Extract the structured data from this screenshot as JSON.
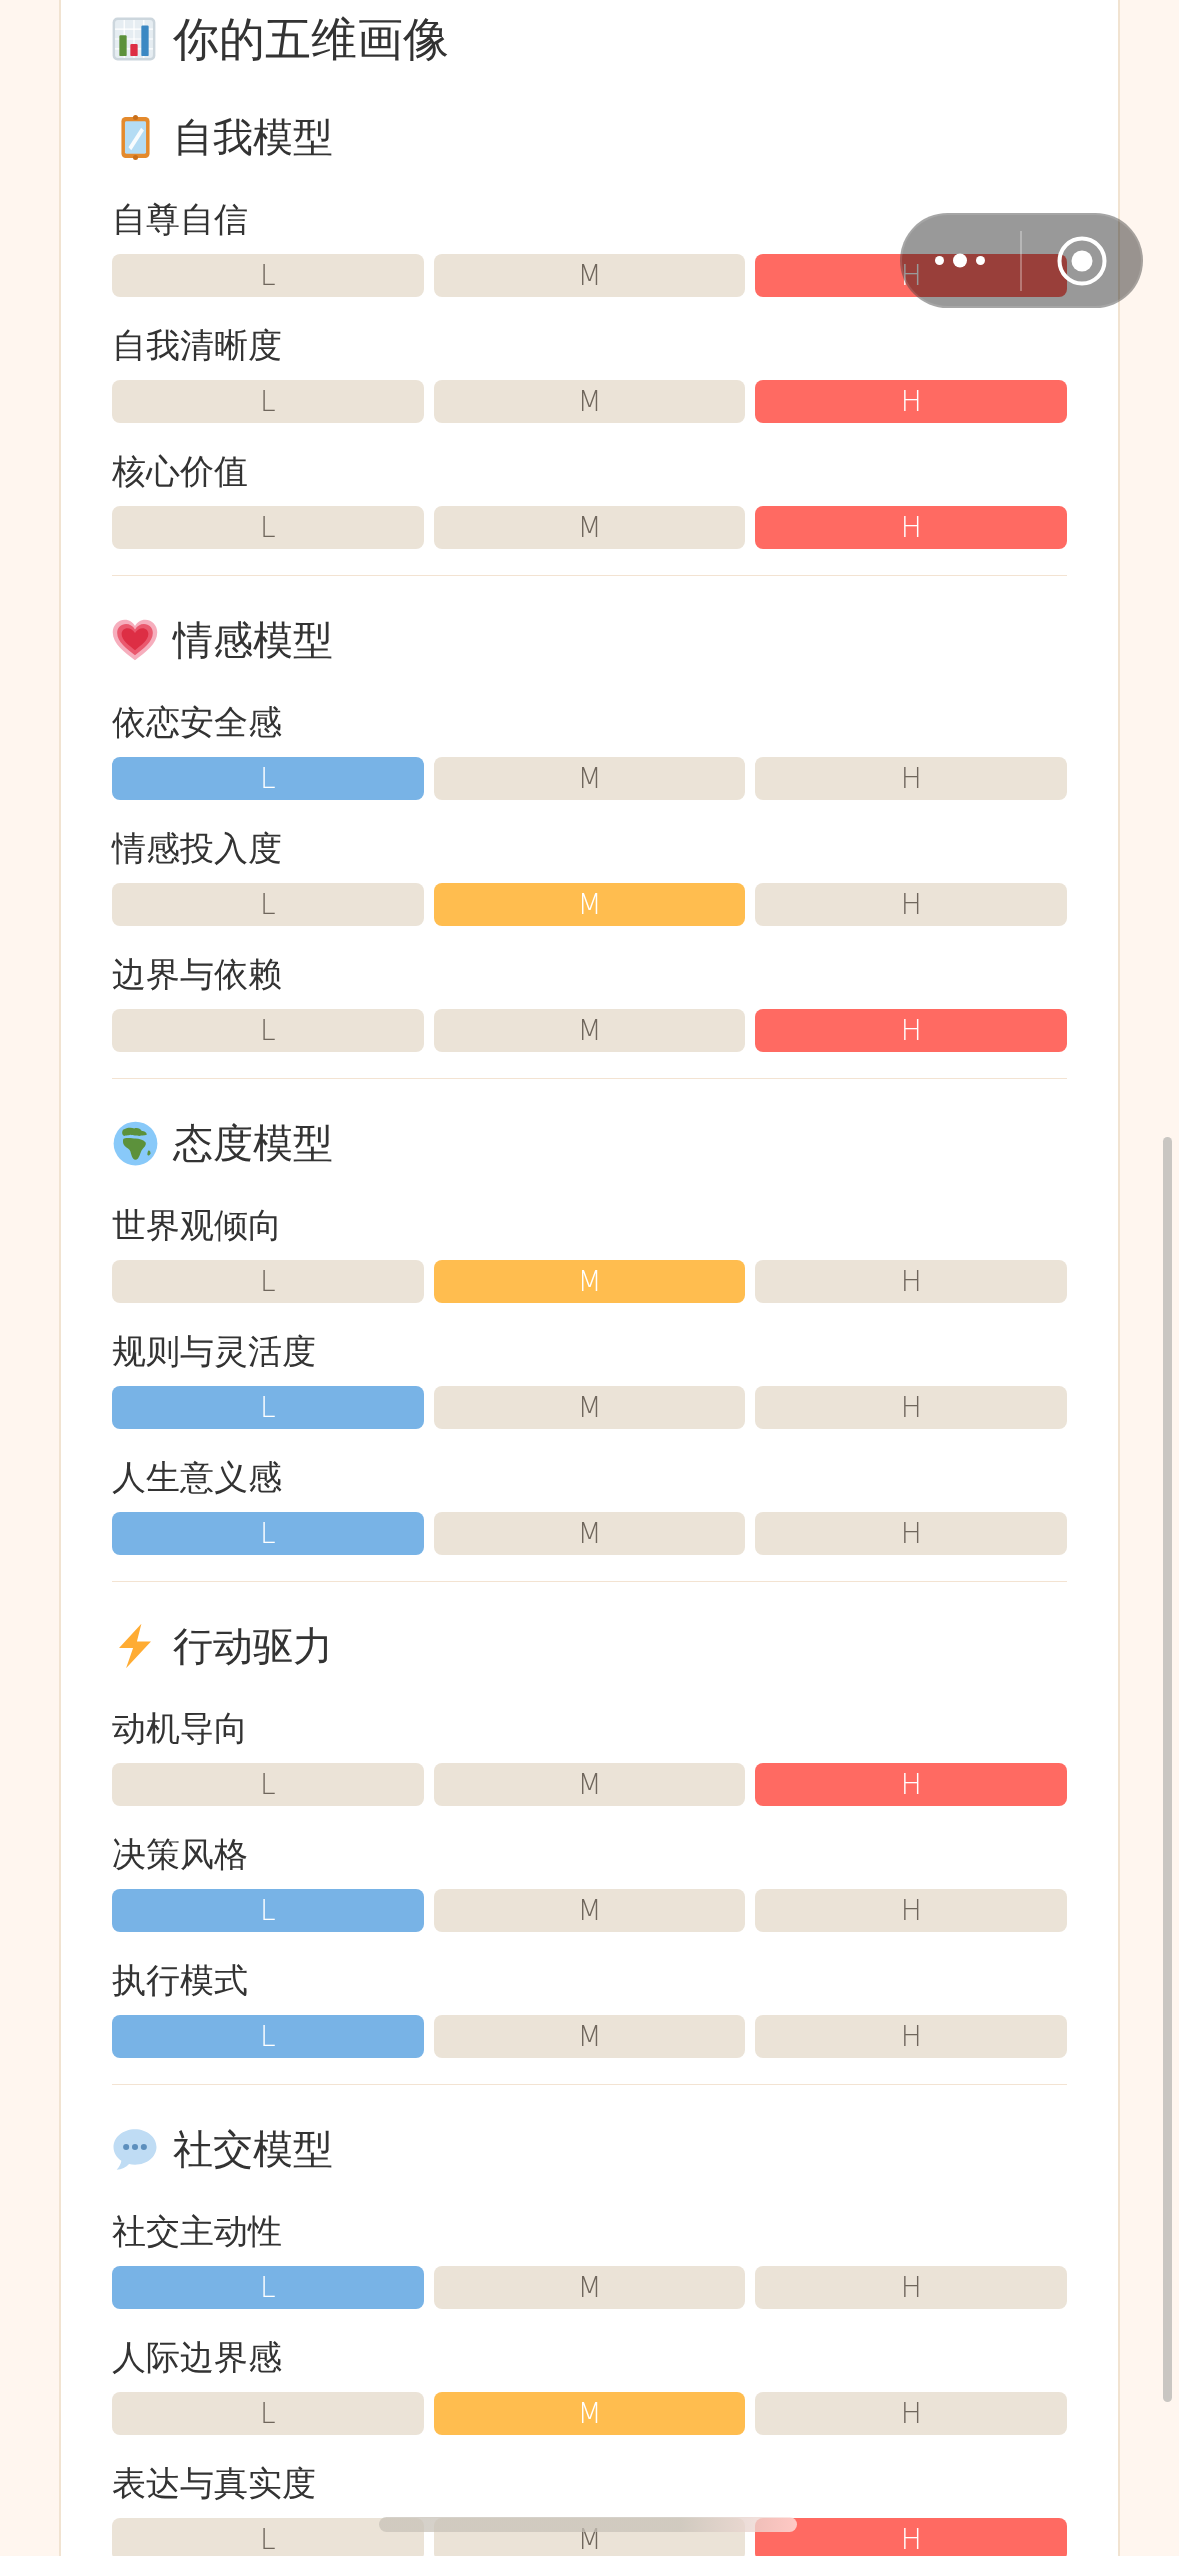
{
  "title": "你的五维画像",
  "sections": [
    {
      "title": "自我模型",
      "items": [
        {
          "label": "自尊自信",
          "options": [
            {
              "label": "L",
              "selected": false
            },
            {
              "label": "M",
              "selected": false
            },
            {
              "label": "H",
              "selected": true
            }
          ]
        },
        {
          "label": "自我清晰度",
          "options": [
            {
              "label": "L",
              "selected": false
            },
            {
              "label": "M",
              "selected": false
            },
            {
              "label": "H",
              "selected": true
            }
          ]
        },
        {
          "label": "核心价值",
          "options": [
            {
              "label": "L",
              "selected": false
            },
            {
              "label": "M",
              "selected": false
            },
            {
              "label": "H",
              "selected": true
            }
          ]
        }
      ]
    },
    {
      "title": "情感模型",
      "items": [
        {
          "label": "依恋安全感",
          "options": [
            {
              "label": "L",
              "selected": true
            },
            {
              "label": "M",
              "selected": false
            },
            {
              "label": "H",
              "selected": false
            }
          ]
        },
        {
          "label": "情感投入度",
          "options": [
            {
              "label": "L",
              "selected": false
            },
            {
              "label": "M",
              "selected": true
            },
            {
              "label": "H",
              "selected": false
            }
          ]
        },
        {
          "label": "边界与依赖",
          "options": [
            {
              "label": "L",
              "selected": false
            },
            {
              "label": "M",
              "selected": false
            },
            {
              "label": "H",
              "selected": true
            }
          ]
        }
      ]
    },
    {
      "title": "态度模型",
      "items": [
        {
          "label": "世界观倾向",
          "options": [
            {
              "label": "L",
              "selected": false
            },
            {
              "label": "M",
              "selected": true
            },
            {
              "label": "H",
              "selected": false
            }
          ]
        },
        {
          "label": "规则与灵活度",
          "options": [
            {
              "label": "L",
              "selected": true
            },
            {
              "label": "M",
              "selected": false
            },
            {
              "label": "H",
              "selected": false
            }
          ]
        },
        {
          "label": "人生意义感",
          "options": [
            {
              "label": "L",
              "selected": true
            },
            {
              "label": "M",
              "selected": false
            },
            {
              "label": "H",
              "selected": false
            }
          ]
        }
      ]
    },
    {
      "title": "行动驱力",
      "items": [
        {
          "label": "动机导向",
          "options": [
            {
              "label": "L",
              "selected": false
            },
            {
              "label": "M",
              "selected": false
            },
            {
              "label": "H",
              "selected": true
            }
          ]
        },
        {
          "label": "决策风格",
          "options": [
            {
              "label": "L",
              "selected": true
            },
            {
              "label": "M",
              "selected": false
            },
            {
              "label": "H",
              "selected": false
            }
          ]
        },
        {
          "label": "执行模式",
          "options": [
            {
              "label": "L",
              "selected": true
            },
            {
              "label": "M",
              "selected": false
            },
            {
              "label": "H",
              "selected": false
            }
          ]
        }
      ]
    },
    {
      "title": "社交模型",
      "items": [
        {
          "label": "社交主动性",
          "options": [
            {
              "label": "L",
              "selected": true
            },
            {
              "label": "M",
              "selected": false
            },
            {
              "label": "H",
              "selected": false
            }
          ]
        },
        {
          "label": "人际边界感",
          "options": [
            {
              "label": "L",
              "selected": false
            },
            {
              "label": "M",
              "selected": true
            },
            {
              "label": "H",
              "selected": false
            }
          ]
        },
        {
          "label": "表达与真实度",
          "options": [
            {
              "label": "L",
              "selected": false
            },
            {
              "label": "M",
              "selected": false
            },
            {
              "label": "H",
              "selected": true
            }
          ]
        }
      ]
    }
  ]
}
